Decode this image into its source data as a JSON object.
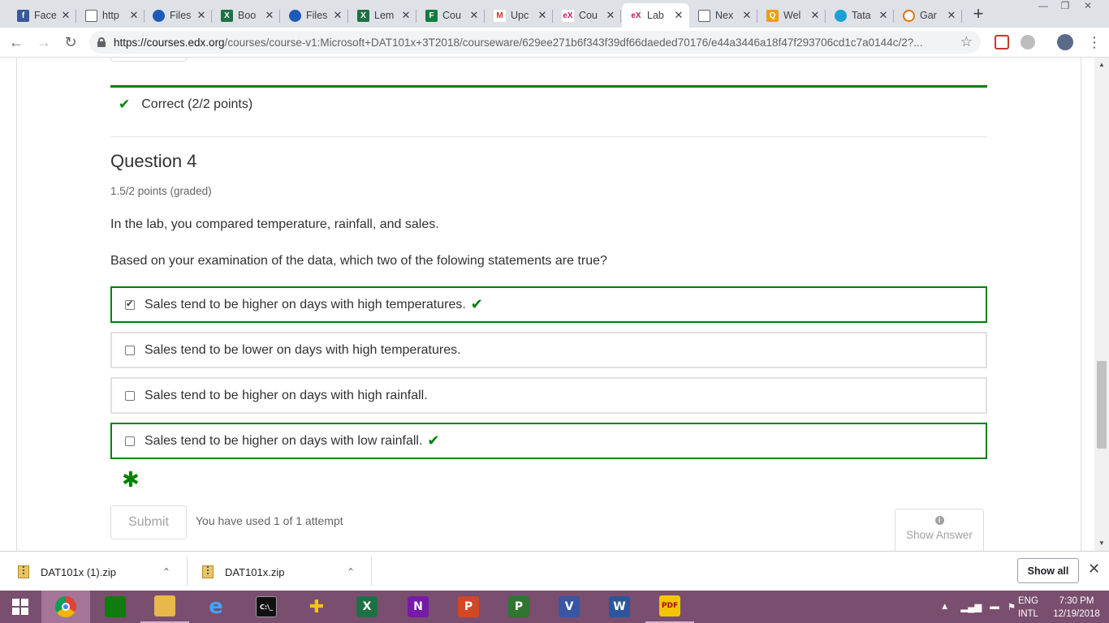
{
  "browser": {
    "tabs": [
      {
        "label": "Face",
        "icon": "facebook-icon",
        "color": "#3b5998",
        "glyph": "f"
      },
      {
        "label": "http",
        "icon": "page-icon",
        "color": "#ffffff",
        "glyph": ""
      },
      {
        "label": "Files",
        "icon": "onedrive-icon",
        "color": "#1e5bb8",
        "glyph": ""
      },
      {
        "label": "Boo",
        "icon": "excel-icon",
        "color": "#1e7145",
        "glyph": "X"
      },
      {
        "label": "Files",
        "icon": "onedrive-icon",
        "color": "#1e5bb8",
        "glyph": ""
      },
      {
        "label": "Lem",
        "icon": "excel-icon",
        "color": "#1e7145",
        "glyph": "X"
      },
      {
        "label": "Cou",
        "icon": "forms-icon",
        "color": "#107c41",
        "glyph": "F"
      },
      {
        "label": "Upc",
        "icon": "gmail-icon",
        "color": "#ffffff",
        "glyph": "M"
      },
      {
        "label": "Cou",
        "icon": "edx-icon",
        "color": "#ffffff",
        "glyph": "eX"
      },
      {
        "label": "Lab",
        "icon": "edx-icon",
        "color": "#ffffff",
        "glyph": "eX",
        "active": true
      },
      {
        "label": "Nex",
        "icon": "page-icon",
        "color": "#ffffff",
        "glyph": ""
      },
      {
        "label": "Wel",
        "icon": "bookmark-icon",
        "color": "#f39c12",
        "glyph": "Q"
      },
      {
        "label": "Tata",
        "icon": "circle-icon",
        "color": "#1a9fd6",
        "glyph": ""
      },
      {
        "label": "Gar",
        "icon": "gauge-icon",
        "color": "#ffffff",
        "glyph": ""
      }
    ],
    "new_tab": "+",
    "url_host": "https://courses.edx.org",
    "url_rest": "/courses/course-v1:Microsoft+DAT101x+3T2018/courseware/629ee271b6f343f39df66daeded70176/e44a3446a18f47f293706cd1c7a0144c/2?..."
  },
  "problem": {
    "status": "Correct (2/2 points)",
    "title": "Question 4",
    "points": "1.5/2 points (graded)",
    "text": "In the lab, you compared temperature, rainfall, and sales.",
    "prompt": "Based on your examination of the data, which two of the folowing statements are true?",
    "choices": [
      {
        "label": "Sales tend to be higher on days with high temperatures.",
        "checked": true,
        "correct": true
      },
      {
        "label": "Sales tend to be lower on days with high temperatures.",
        "checked": false,
        "correct": false
      },
      {
        "label": "Sales tend to be higher on days with high rainfall.",
        "checked": false,
        "correct": false
      },
      {
        "label": "Sales tend to be higher on days with low rainfall.",
        "checked": false,
        "correct": true
      }
    ],
    "asterisk": "✱",
    "submit_label": "Submit",
    "attempts": "You have used 1 of 1 attempt",
    "show_answer": "Show Answer",
    "accent_color": "#008100"
  },
  "downloads": {
    "items": [
      {
        "name": "DAT101x (1).zip"
      },
      {
        "name": "DAT101x.zip"
      }
    ],
    "show_all": "Show all"
  },
  "taskbar": {
    "apps": [
      {
        "name": "chrome",
        "glyph": "",
        "color": "#ffffff",
        "active": true
      },
      {
        "name": "store",
        "glyph": "",
        "color": "#107c10"
      },
      {
        "name": "file-explorer",
        "glyph": "",
        "color": "#e8b84a",
        "open": true
      },
      {
        "name": "edge",
        "glyph": "e",
        "color": "#1f7ad0"
      },
      {
        "name": "cmd",
        "glyph": "C:\\_",
        "color": "#111111"
      },
      {
        "name": "tool",
        "glyph": "✚",
        "color": "#f1c40f"
      },
      {
        "name": "excel",
        "glyph": "X",
        "color": "#1e7145"
      },
      {
        "name": "onenote",
        "glyph": "N",
        "color": "#7719aa"
      },
      {
        "name": "powerpoint",
        "glyph": "P",
        "color": "#d24726"
      },
      {
        "name": "project",
        "glyph": "P",
        "color": "#31752f"
      },
      {
        "name": "visio",
        "glyph": "V",
        "color": "#3955a3"
      },
      {
        "name": "word",
        "glyph": "W",
        "color": "#2b579a"
      },
      {
        "name": "pdf",
        "glyph": "PDF",
        "color": "#f5c400",
        "open": true
      }
    ],
    "lang_top": "ENG",
    "lang_bottom": "INTL",
    "time": "7:30 PM",
    "date": "12/19/2018"
  }
}
